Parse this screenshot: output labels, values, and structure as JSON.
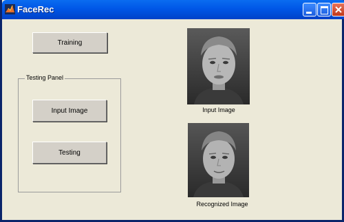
{
  "window": {
    "title": "FaceRec"
  },
  "buttons": {
    "training": "Training",
    "input_image": "Input Image",
    "testing": "Testing"
  },
  "panel": {
    "title": "Testing Panel"
  },
  "images": {
    "input_caption": "Input Image",
    "recognized_caption": "Recognized Image"
  },
  "icons": {
    "app": "matlab-icon",
    "minimize": "minimize-icon",
    "maximize": "maximize-icon",
    "close": "close-icon"
  },
  "colors": {
    "titlebar": "#0057E7",
    "face_background": "#ECE9D8"
  }
}
